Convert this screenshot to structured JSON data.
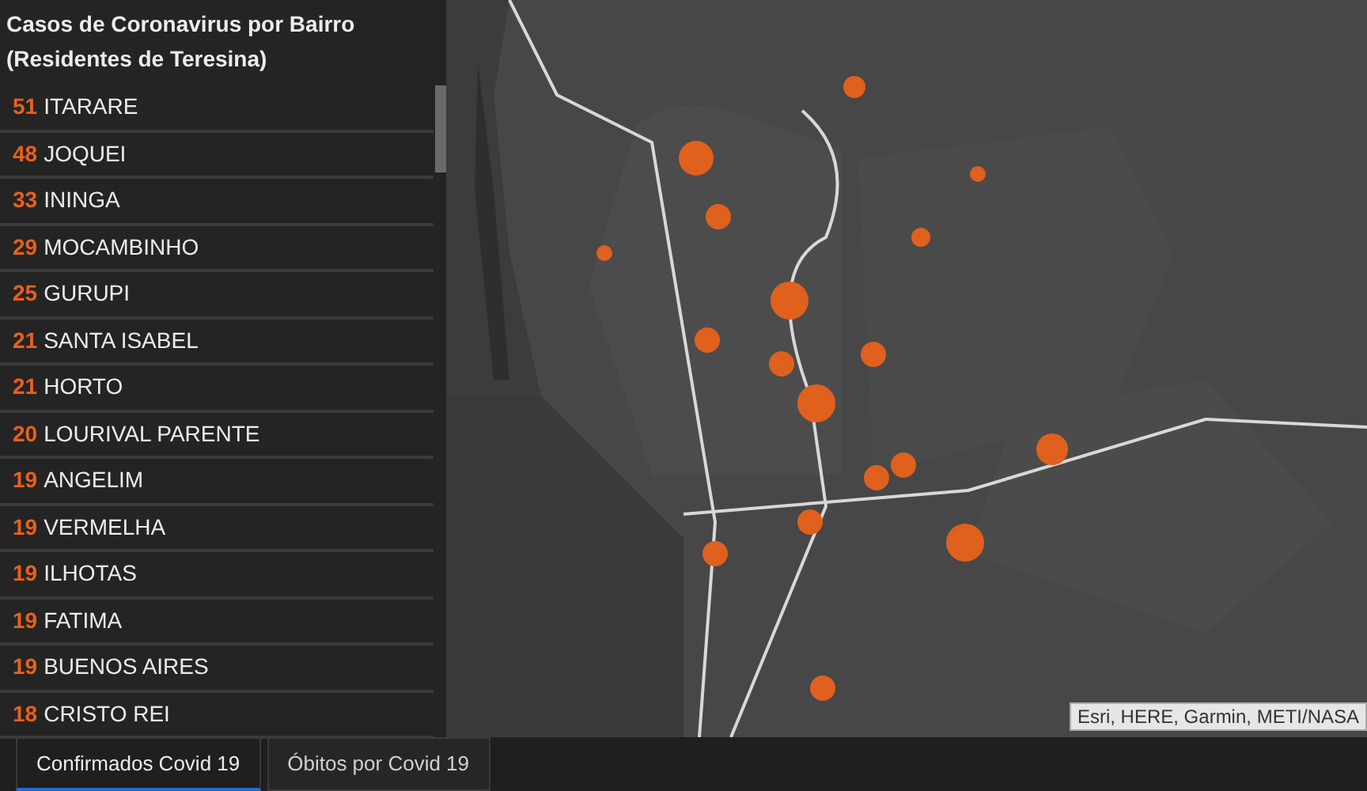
{
  "list": {
    "title": "Casos de Coronavirus por Bairro (Residentes de Teresina)",
    "items": [
      {
        "count": "51",
        "name": "ITARARE"
      },
      {
        "count": "48",
        "name": "JOQUEI"
      },
      {
        "count": "33",
        "name": "ININGA"
      },
      {
        "count": "29",
        "name": "MOCAMBINHO"
      },
      {
        "count": "25",
        "name": "GURUPI"
      },
      {
        "count": "21",
        "name": "SANTA ISABEL"
      },
      {
        "count": "21",
        "name": "HORTO"
      },
      {
        "count": "20",
        "name": "LOURIVAL PARENTE"
      },
      {
        "count": "19",
        "name": "ANGELIM"
      },
      {
        "count": "19",
        "name": "VERMELHA"
      },
      {
        "count": "19",
        "name": "ILHOTAS"
      },
      {
        "count": "19",
        "name": "FATIMA"
      },
      {
        "count": "19",
        "name": "BUENOS AIRES"
      },
      {
        "count": "18",
        "name": "CRISTO REI"
      }
    ]
  },
  "map": {
    "attribution": "Esri, HERE, Garmin, METI/NASA"
  },
  "tabs": [
    {
      "label": "Confirmados Covid 19",
      "selected": true
    },
    {
      "label": "Óbitos por Covid 19",
      "selected": false
    }
  ]
}
